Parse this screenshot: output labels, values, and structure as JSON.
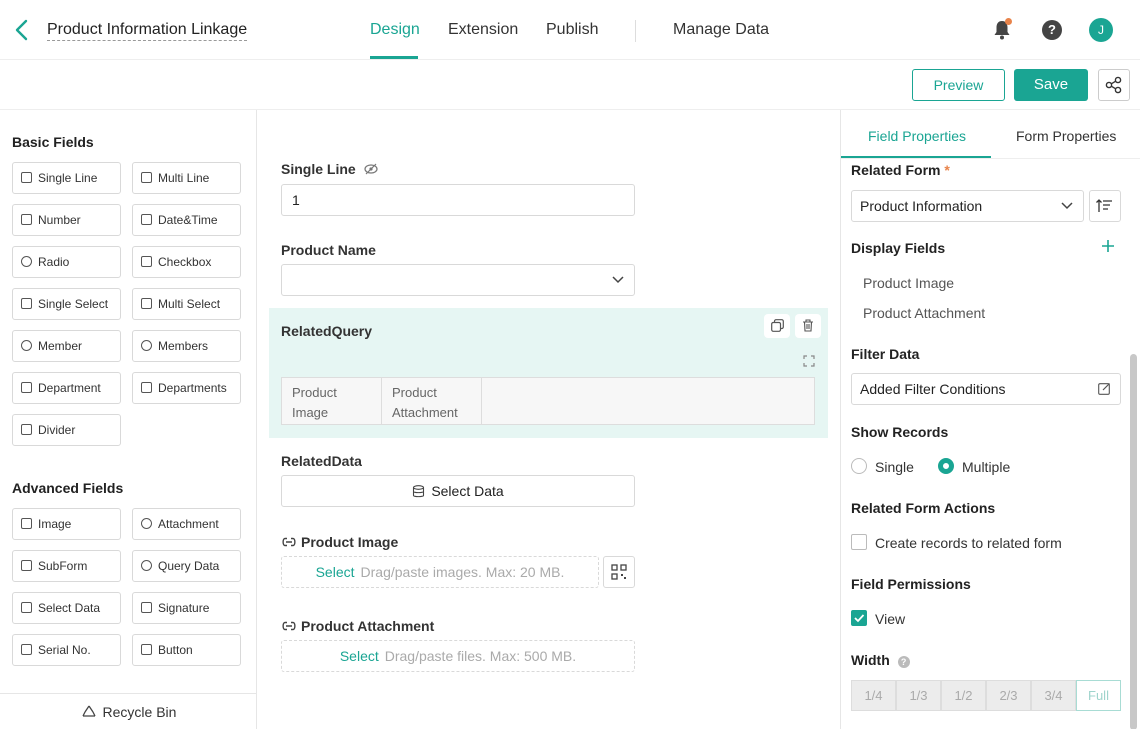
{
  "header": {
    "back_icon": "chevron-left-icon",
    "app_title": "Product Information Linkage",
    "tabs": [
      {
        "label": "Design"
      },
      {
        "label": "Extension"
      },
      {
        "label": "Publish"
      },
      {
        "label": "Manage Data"
      }
    ],
    "active_tab": "Design",
    "help_glyph": "?",
    "avatar_initial": "J",
    "accent_color": "#1aa593",
    "notification_dot_color": "#e8834a"
  },
  "toolbar": {
    "preview_label": "Preview",
    "save_label": "Save",
    "share_icon": "share-icon"
  },
  "left_panel": {
    "basic_title": "Basic Fields",
    "basic_fields": [
      {
        "label": "Single Line",
        "icon": "single-line-icon"
      },
      {
        "label": "Multi Line",
        "icon": "multi-line-icon"
      },
      {
        "label": "Number",
        "icon": "number-icon"
      },
      {
        "label": "Date&Time",
        "icon": "calendar-icon"
      },
      {
        "label": "Radio",
        "icon": "radio-icon"
      },
      {
        "label": "Checkbox",
        "icon": "checkbox-icon"
      },
      {
        "label": "Single Select",
        "icon": "single-select-icon"
      },
      {
        "label": "Multi Select",
        "icon": "multi-select-icon"
      },
      {
        "label": "Member",
        "icon": "member-icon"
      },
      {
        "label": "Members",
        "icon": "members-icon"
      },
      {
        "label": "Department",
        "icon": "department-icon"
      },
      {
        "label": "Departments",
        "icon": "departments-icon"
      },
      {
        "label": "Divider",
        "icon": "divider-icon"
      }
    ],
    "advanced_title": "Advanced Fields",
    "advanced_fields": [
      {
        "label": "Image",
        "icon": "image-icon"
      },
      {
        "label": "Attachment",
        "icon": "attachment-icon"
      },
      {
        "label": "SubForm",
        "icon": "subform-icon"
      },
      {
        "label": "Query Data",
        "icon": "query-data-icon"
      },
      {
        "label": "Select Data",
        "icon": "select-data-icon"
      },
      {
        "label": "Signature",
        "icon": "signature-icon"
      },
      {
        "label": "Serial No.",
        "icon": "serial-no-icon"
      },
      {
        "label": "Button",
        "icon": "button-icon"
      }
    ],
    "recycle_label": "Recycle Bin"
  },
  "canvas": {
    "single_line": {
      "label": "Single Line",
      "value": "1"
    },
    "product_name": {
      "label": "Product Name",
      "value": ""
    },
    "related_query": {
      "label": "RelatedQuery",
      "columns": [
        {
          "line1": "Product",
          "line2": "Image"
        },
        {
          "line1": "Product",
          "line2": "Attachment"
        }
      ]
    },
    "related_data": {
      "label": "RelatedData",
      "button": "Select Data"
    },
    "product_image": {
      "label": "Product Image",
      "select": "Select",
      "hint": "Drag/paste images. Max: 20 MB."
    },
    "product_attachment": {
      "label": "Product Attachment",
      "select": "Select",
      "hint": "Drag/paste files. Max: 500 MB."
    }
  },
  "right_panel": {
    "tabs": [
      {
        "label": "Field Properties"
      },
      {
        "label": "Form Properties"
      }
    ],
    "active_tab": "Field Properties",
    "related_form": {
      "label": "Related Form",
      "required_mark": "*",
      "value": "Product Information"
    },
    "display_fields": {
      "label": "Display Fields",
      "items": [
        "Product Image",
        "Product Attachment"
      ]
    },
    "filter_data": {
      "label": "Filter Data",
      "value": "Added Filter Conditions"
    },
    "show_records": {
      "label": "Show Records",
      "options": [
        "Single",
        "Multiple"
      ],
      "selected": "Multiple"
    },
    "related_form_actions": {
      "label": "Related Form Actions",
      "option": "Create records to related form",
      "checked": false
    },
    "field_permissions": {
      "label": "Field Permissions",
      "option": "View",
      "checked": true
    },
    "width": {
      "label": "Width",
      "options": [
        "1/4",
        "1/3",
        "1/2",
        "2/3",
        "3/4",
        "Full"
      ],
      "selected": "Full"
    }
  }
}
